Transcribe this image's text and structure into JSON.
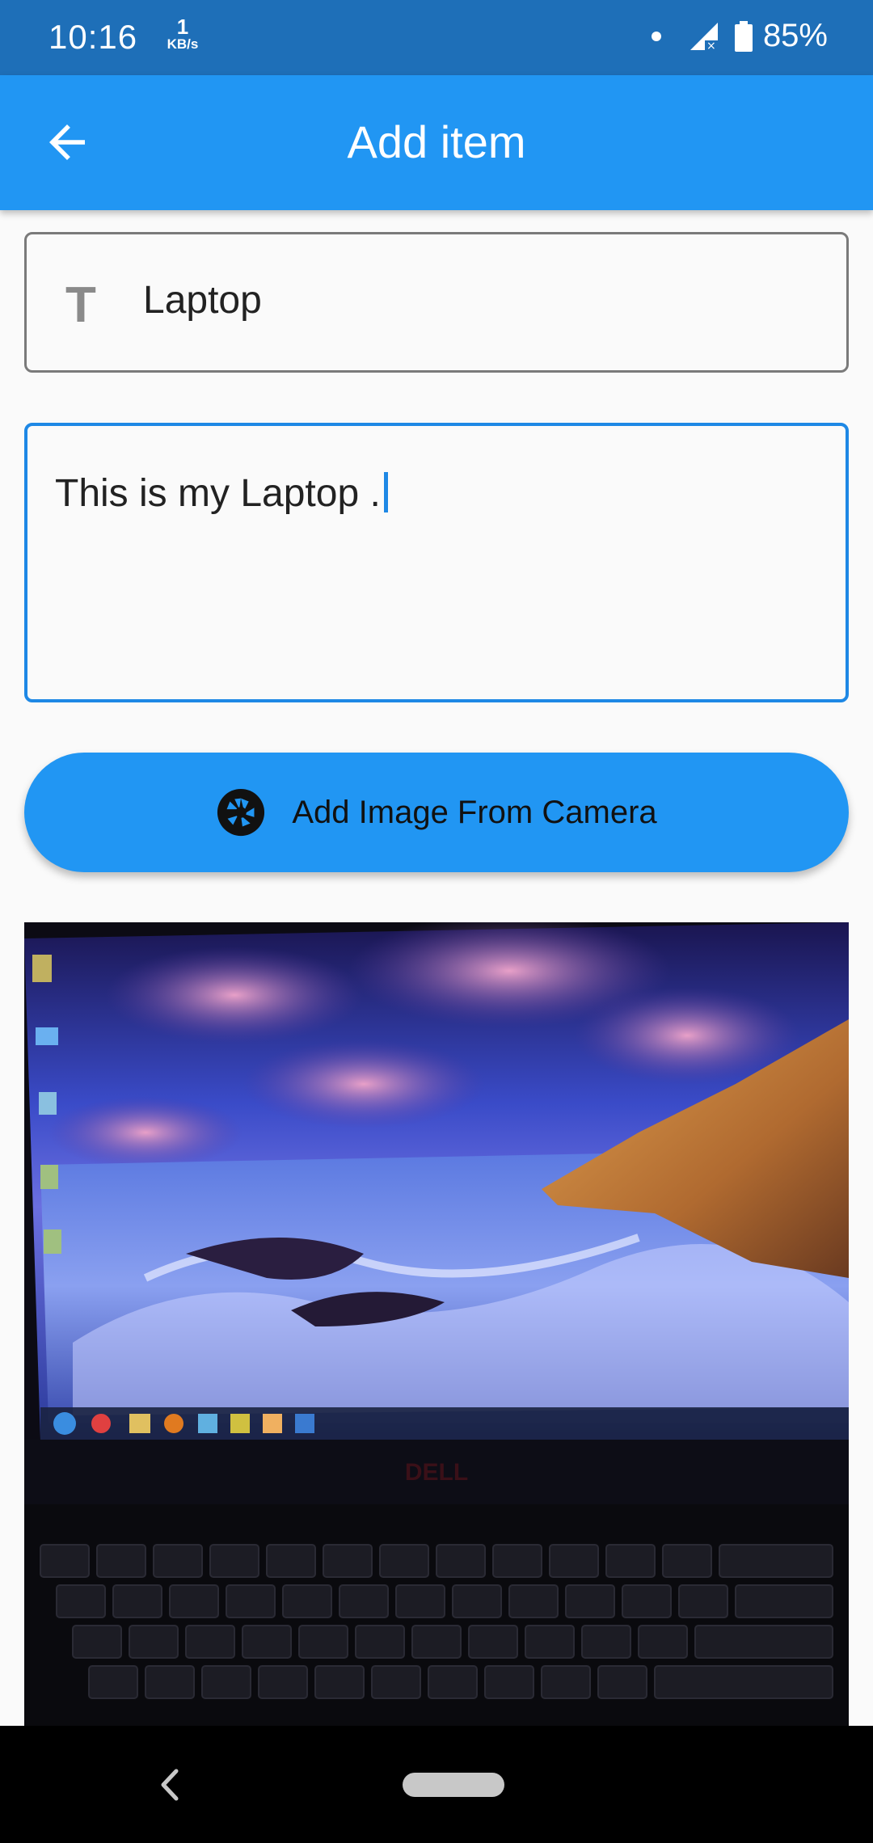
{
  "status_bar": {
    "time": "10:16",
    "speed_value": "1",
    "speed_unit": "KB/s",
    "battery": "85%",
    "icons": [
      "notification-dot-icon",
      "signal-icon",
      "battery-icon"
    ]
  },
  "app_bar": {
    "title": "Add item",
    "back_icon": "arrow-back-icon"
  },
  "form": {
    "title_field": {
      "icon": "T",
      "value": "Laptop"
    },
    "description_field": {
      "value": "This is my Laptop ."
    },
    "camera_button": {
      "label": "Add Image From Camera",
      "icon": "camera-shutter-icon"
    }
  },
  "photo": {
    "subject": "laptop-screen-photo"
  },
  "nav_bar": {
    "icons": [
      "nav-back-icon",
      "nav-home-pill"
    ]
  },
  "colors": {
    "status_bar": "#1e6fb8",
    "app_bar": "#2196f3",
    "focus_border": "#1e88e5",
    "background": "#fafafa"
  }
}
